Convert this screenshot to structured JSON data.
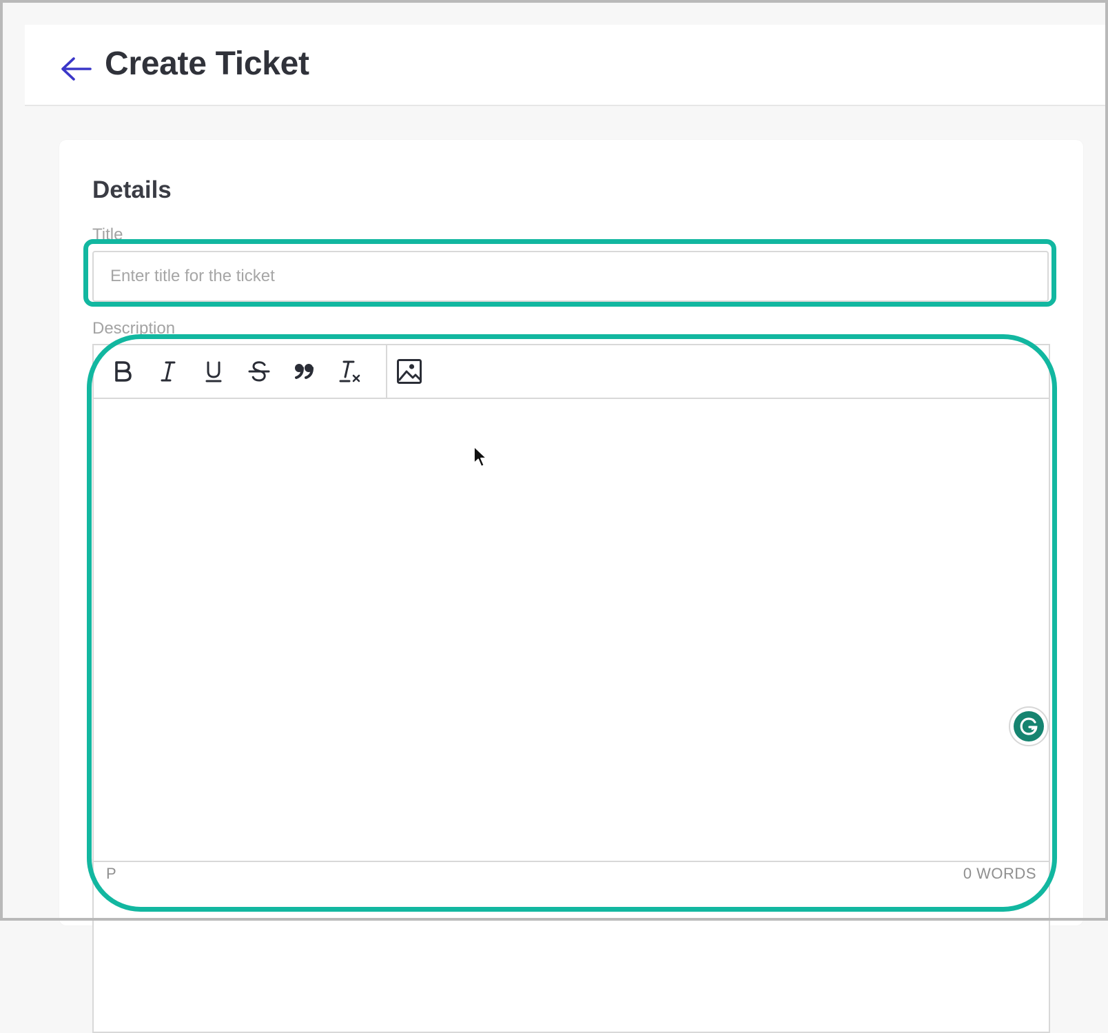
{
  "header": {
    "back_icon": "arrow-left-icon",
    "title": "Create Ticket"
  },
  "form": {
    "section_title": "Details",
    "title_label": "Title",
    "title_placeholder": "Enter title for the ticket",
    "title_value": "",
    "description_label": "Description"
  },
  "editor": {
    "toolbar": [
      {
        "name": "bold",
        "icon": "bold-icon"
      },
      {
        "name": "italic",
        "icon": "italic-icon"
      },
      {
        "name": "underline",
        "icon": "underline-icon"
      },
      {
        "name": "strikethrough",
        "icon": "strikethrough-icon"
      },
      {
        "name": "blockquote",
        "icon": "quote-icon"
      },
      {
        "name": "clear-formatting",
        "icon": "clear-format-icon"
      },
      {
        "name": "insert-image",
        "icon": "image-icon"
      }
    ],
    "status_path": "P",
    "word_count": "0 WORDS"
  },
  "grammarly": {
    "icon": "grammarly-icon"
  },
  "colors": {
    "accent_back": "#3a36c8",
    "highlight": "#12b7a0",
    "grammarly": "#168470",
    "title_text": "#30323a"
  }
}
